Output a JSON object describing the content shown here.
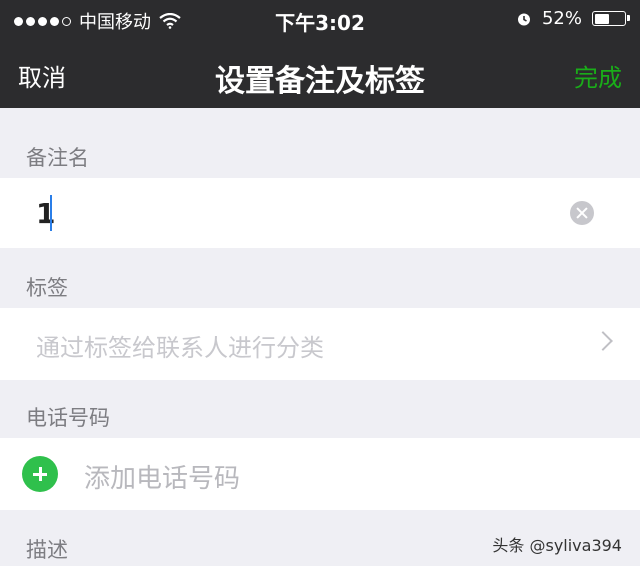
{
  "status_bar": {
    "carrier": "中国移动",
    "time": "下午3:02",
    "battery_percent": "52%",
    "battery_level": 0.52,
    "icons": [
      "signal-dots-icon",
      "wifi-icon",
      "alarm-clock-icon",
      "battery-icon"
    ]
  },
  "nav": {
    "cancel_label": "取消",
    "title": "设置备注及标签",
    "done_label": "完成",
    "done_color": "#1aad19"
  },
  "sections": {
    "note": {
      "label": "备注名",
      "value": "1"
    },
    "tags": {
      "label": "标签",
      "placeholder": "通过标签给联系人进行分类"
    },
    "phone": {
      "label": "电话号码",
      "add_label": "添加电话号码",
      "accent": "#2fc04c"
    },
    "description": {
      "label": "描述"
    }
  },
  "watermark": "头条 @syliva394"
}
